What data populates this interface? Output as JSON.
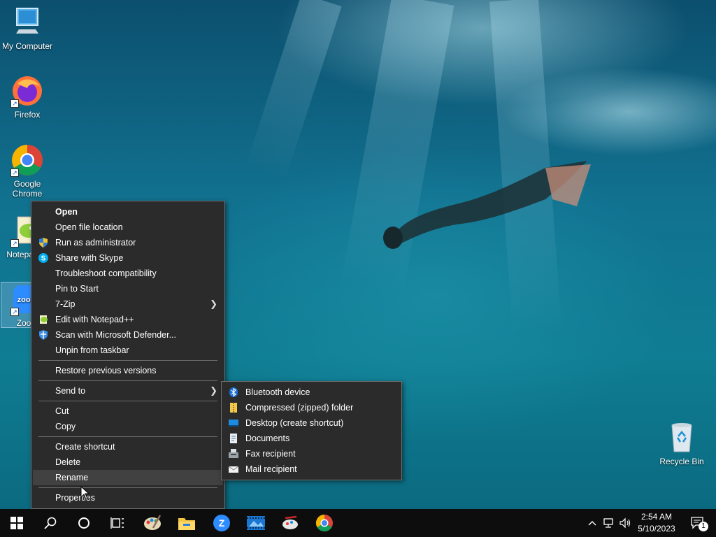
{
  "desktop": {
    "icons": [
      {
        "label": "My Computer"
      },
      {
        "label": "Firefox"
      },
      {
        "label": "Google Chrome"
      },
      {
        "label": "Notepad++"
      },
      {
        "label": "Zoom"
      },
      {
        "label": "Recycle Bin"
      }
    ]
  },
  "context_menu": {
    "items": [
      {
        "label": "Open"
      },
      {
        "label": "Open file location"
      },
      {
        "label": "Run as administrator",
        "icon": "shield-icon"
      },
      {
        "label": "Share with Skype",
        "icon": "skype-icon"
      },
      {
        "label": "Troubleshoot compatibility"
      },
      {
        "label": "Pin to Start"
      },
      {
        "label": "7-Zip"
      },
      {
        "label": "Edit with Notepad++",
        "icon": "notepad-plus-plus-icon"
      },
      {
        "label": "Scan with Microsoft Defender...",
        "icon": "defender-icon"
      },
      {
        "label": "Unpin from taskbar"
      },
      {
        "label": "Restore previous versions"
      },
      {
        "label": "Send to"
      },
      {
        "label": "Cut"
      },
      {
        "label": "Copy"
      },
      {
        "label": "Create shortcut"
      },
      {
        "label": "Delete"
      },
      {
        "label": "Rename"
      },
      {
        "label": "Properties"
      }
    ]
  },
  "send_to_menu": {
    "items": [
      {
        "label": "Bluetooth device"
      },
      {
        "label": "Compressed (zipped) folder"
      },
      {
        "label": "Desktop (create shortcut)"
      },
      {
        "label": "Documents"
      },
      {
        "label": "Fax recipient"
      },
      {
        "label": "Mail recipient"
      }
    ]
  },
  "taskbar": {
    "apps": [
      "start-icon",
      "search-icon",
      "cortana-icon",
      "task-view-icon",
      "paint-icon",
      "file-explorer-icon",
      "zoom-icon",
      "photos-icon",
      "snipping-icon",
      "chrome-icon"
    ],
    "clock": {
      "time": "2:54 AM",
      "date": "5/10/2023"
    },
    "notification_count": "1"
  },
  "colors": {
    "menu_bg": "#2b2b2b",
    "menu_highlight": "#414141",
    "taskbar_bg": "#0d0d0d"
  }
}
